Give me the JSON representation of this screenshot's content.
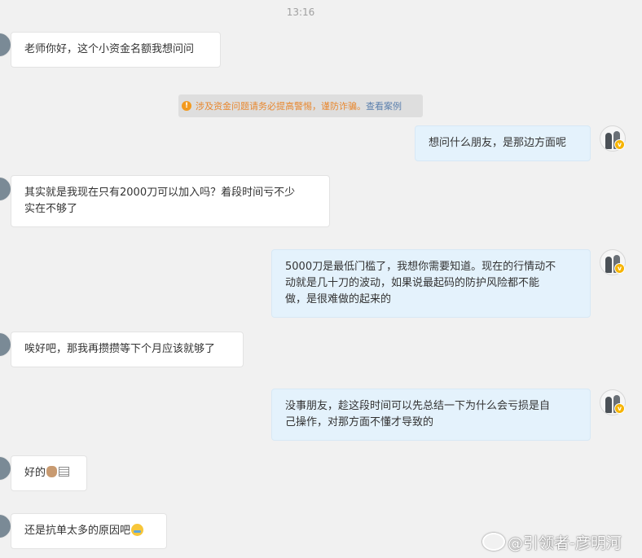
{
  "time": "13:16",
  "notice": {
    "text": "涉及资金问题请务必提高警惕，谨防诈骗。",
    "link": "查看案例"
  },
  "messages": [
    {
      "side": "in",
      "lines": [
        "老师你好，这个小资金名额我想问问"
      ]
    },
    {
      "side": "out",
      "lines": [
        "想问什么朋友，是那边方面呢"
      ]
    },
    {
      "side": "in",
      "lines": [
        "其实就是我现在只有2000刀可以加入吗？着段时间亏不少",
        "实在不够了"
      ]
    },
    {
      "side": "out",
      "lines": [
        "5000刀是最低门槛了，我想你需要知道。现在的行情动不",
        "动就是几十刀的波动，如果说最起码的防护风险都不能",
        "做，是很难做的起来的"
      ]
    },
    {
      "side": "in",
      "lines": [
        "唉好吧，那我再攒攒等下个月应该就够了"
      ]
    },
    {
      "side": "out",
      "lines": [
        "没事朋友，趁这段时间可以先总结一下为什么会亏损是自",
        "己操作，对那方面不懂才导致的"
      ]
    },
    {
      "side": "in",
      "lines": [
        "好的"
      ],
      "emojis": [
        "ok-hand-emoji",
        "document-emoji"
      ]
    },
    {
      "side": "in",
      "lines": [
        "还是抗单太多的原因吧"
      ],
      "emojis": [
        "laughing-tears-emoji"
      ]
    }
  ],
  "watermark": "@引领者-彦明河",
  "colors": {
    "background": "#f1f1f1",
    "incoming_bubble": "#ffffff",
    "outgoing_bubble": "#e4f2fc",
    "notice_text": "#e8872e",
    "notice_link": "#5a7fad"
  }
}
